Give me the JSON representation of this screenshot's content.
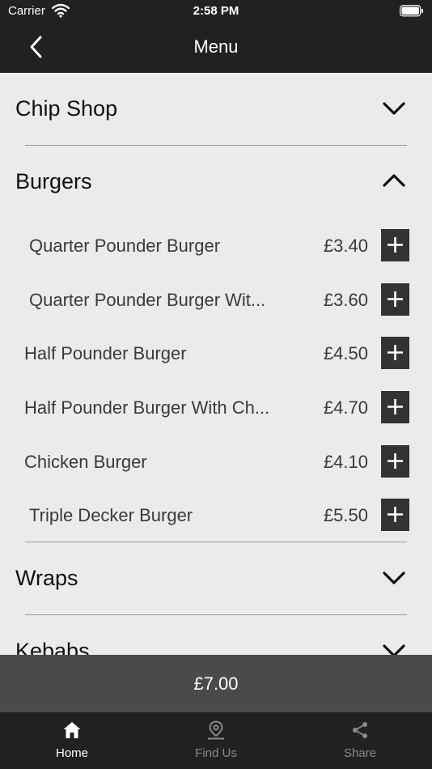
{
  "status_bar": {
    "carrier": "Carrier",
    "time": "2:58 PM"
  },
  "nav": {
    "title": "Menu"
  },
  "categories": [
    {
      "label": "Chip Shop",
      "state": "collapsed"
    },
    {
      "label": "Burgers",
      "state": "expanded"
    },
    {
      "label": "Wraps",
      "state": "collapsed"
    },
    {
      "label": "Kebabs",
      "state": "collapsed"
    }
  ],
  "burgers": [
    {
      "name": "Quarter Pounder Burger",
      "price": "£3.40"
    },
    {
      "name": "Quarter Pounder Burger Wit...",
      "price": "£3.60"
    },
    {
      "name": "Half Pounder Burger",
      "price": "£4.50"
    },
    {
      "name": "Half Pounder Burger With Ch...",
      "price": "£4.70"
    },
    {
      "name": "Chicken Burger",
      "price": "£4.10"
    },
    {
      "name": "Triple Decker Burger",
      "price": "£5.50"
    }
  ],
  "basket": {
    "total": "£7.00"
  },
  "tabs": [
    {
      "label": "Home",
      "icon": "home-icon",
      "active": true
    },
    {
      "label": "Find Us",
      "icon": "location-pin-icon",
      "active": false
    },
    {
      "label": "Share",
      "icon": "share-icon",
      "active": false
    }
  ],
  "colors": {
    "bar_dark": "#212121",
    "background": "#ebebeb",
    "add_button": "#333333",
    "total_bar": "#4a4a4a"
  }
}
